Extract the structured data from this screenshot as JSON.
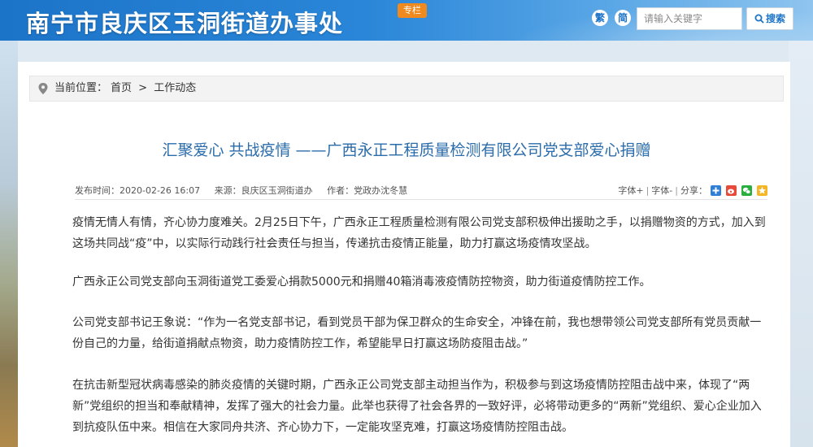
{
  "header": {
    "site_title": "南宁市良庆区玉洞街道办事处",
    "tag": "专栏",
    "lang_traditional": "繁",
    "lang_simplified": "简",
    "search_placeholder": "请输入关键字",
    "search_button": "搜索"
  },
  "breadcrumb": {
    "prefix": "当前位置：",
    "home": "首页",
    "separator": ">",
    "current": "工作动态"
  },
  "article": {
    "title": "汇聚爱心 共战疫情 ——广西永正工程质量检测有限公司党支部爱心捐赠",
    "meta": {
      "publish_time": "发布时间：2020-02-26 16:07",
      "source": "来源：良庆区玉洞街道办",
      "author": "作者：党政办沈冬慧",
      "font_plus": "字体+",
      "separator": "|",
      "font_minus": "字体-",
      "share": "分享："
    },
    "paragraphs": [
      "疫情无情人有情，齐心协力度难关。2月25日下午，广西永正工程质量检测有限公司党支部积极伸出援助之手，以捐赠物资的方式，加入到这场共同战“疫”中，以实际行动践行社会责任与担当，传递抗击疫情正能量，助力打赢这场疫情攻坚战。",
      "广西永正公司党支部向玉洞街道党工委爱心捐款5000元和捐赠40箱消毒液疫情防控物资，助力街道疫情防控工作。",
      "公司党支部书记王象说：“作为一名党支部书记，看到党员干部为保卫群众的生命安全，冲锋在前，我也想带领公司党支部所有党员贡献一份自己的力量，给街道捐献点物资，助力疫情防控工作，希望能早日打赢这场防疫阻击战。”",
      "在抗击新型冠状病毒感染的肺炎疫情的关键时期，广西永正公司党支部主动担当作为，积极参与到这场疫情防控阻击战中来，体现了“两新”党组织的担当和奉献精神，发挥了强大的社会力量。此举也获得了社会各界的一致好评，必将带动更多的“两新”党组织、爱心企业加入到抗疫队伍中来。相信在大家同舟共济、齐心协力下，一定能攻坚克难，打赢这场疫情防控阻击战。"
    ]
  },
  "colors": {
    "header_blue": "#1c74c8",
    "title_blue": "#2b6cab",
    "tag_orange": "#f08a1f"
  }
}
